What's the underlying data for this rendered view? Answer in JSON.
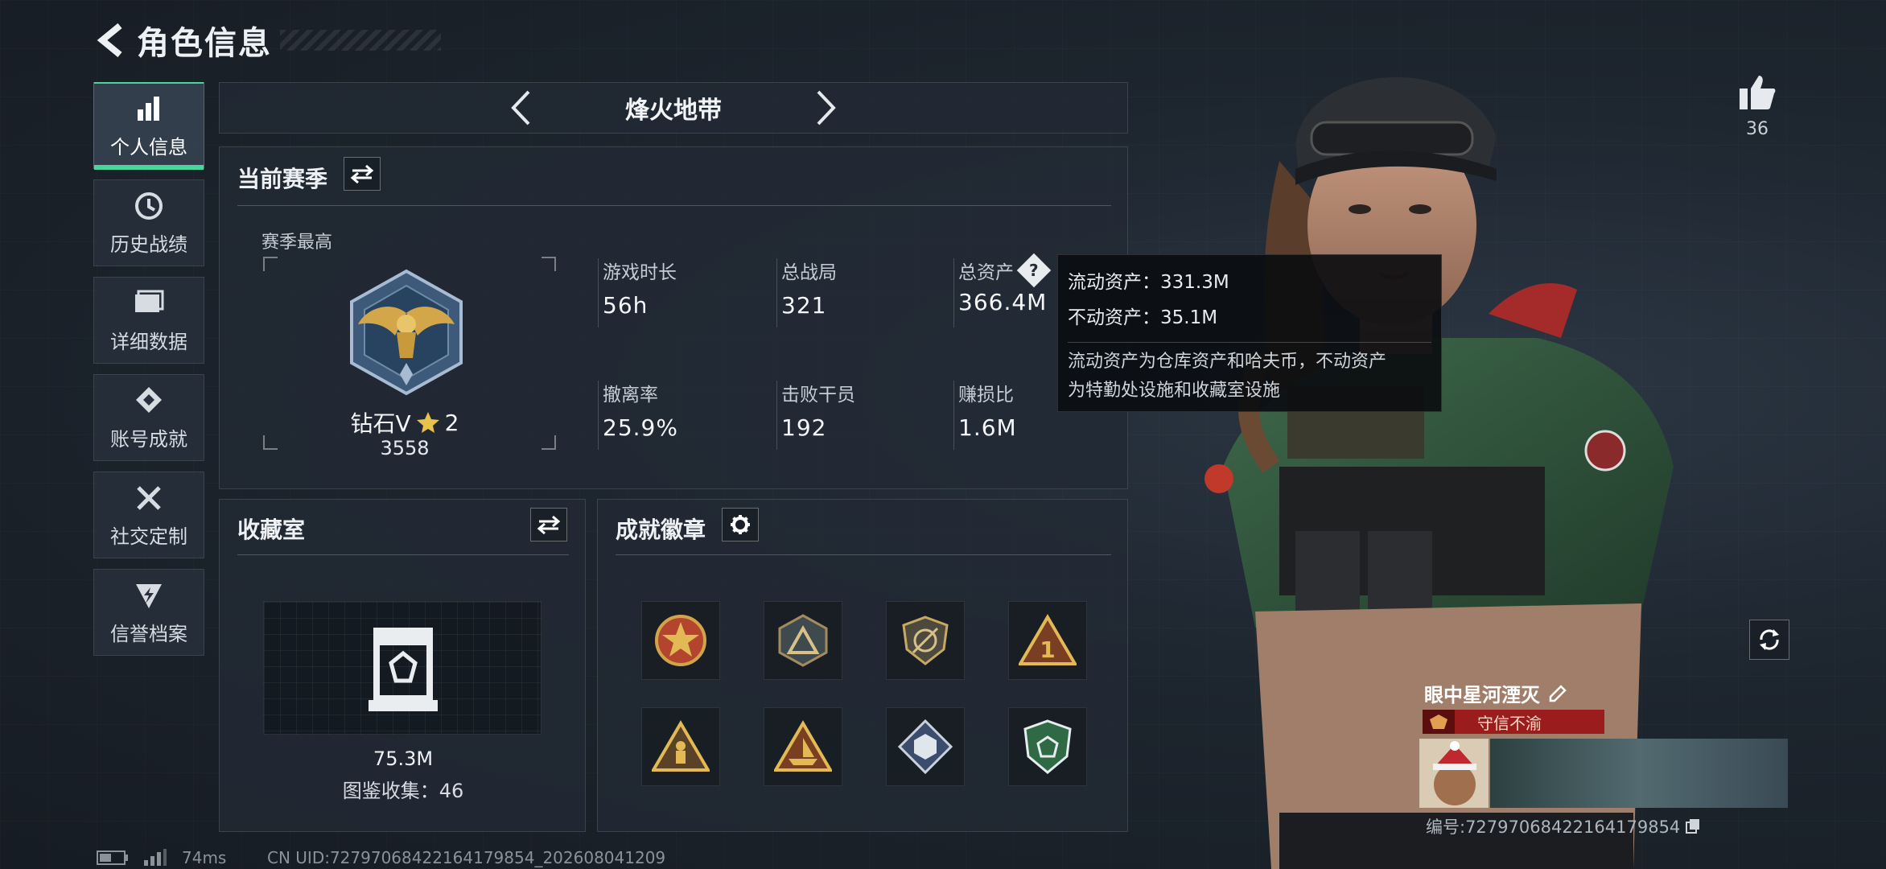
{
  "header": {
    "title": "角色信息"
  },
  "sidebar": {
    "items": [
      {
        "label": "个人信息",
        "icon": "bar-chart-icon",
        "active": true
      },
      {
        "label": "历史战绩",
        "icon": "history-icon",
        "active": false
      },
      {
        "label": "详细数据",
        "icon": "folder-icon",
        "active": false
      },
      {
        "label": "账号成就",
        "icon": "achievement-icon",
        "active": false
      },
      {
        "label": "社交定制",
        "icon": "tools-icon",
        "active": false
      },
      {
        "label": "信誉档案",
        "icon": "shield-bolt-icon",
        "active": false
      }
    ]
  },
  "mode": {
    "title": "烽火地带"
  },
  "season": {
    "title": "当前赛季",
    "best_label": "赛季最高",
    "rank_name": "钻石V",
    "rank_stars": "2",
    "rank_score": "3558",
    "stats": [
      {
        "label": "游戏时长",
        "value": "56h"
      },
      {
        "label": "总战局",
        "value": "321"
      },
      {
        "label": "总资产",
        "value": "366.4M"
      },
      {
        "label": "撤离率",
        "value": "25.9%"
      },
      {
        "label": "击败干员",
        "value": "192"
      },
      {
        "label": "赚损比",
        "value": "1.6M"
      }
    ]
  },
  "tooltip": {
    "line1": "流动资产：331.3M",
    "line2": "不动资产：35.1M",
    "desc1": "流动资产为仓库资产和哈夫币，不动资产",
    "desc2": "为特勤处设施和收藏室设施"
  },
  "collection": {
    "title": "收藏室",
    "value": "75.3M",
    "catalog": "图鉴收集：46"
  },
  "badges": {
    "title": "成就徽章",
    "items": [
      "star-medal-badge",
      "triangle-badge",
      "slash-shield-badge",
      "number-one-badge",
      "soldier-triangle-badge",
      "boat-triangle-badge",
      "cube-diamond-badge",
      "green-shield-badge"
    ]
  },
  "profile": {
    "likes": "36",
    "name": "眼中星河湮灭",
    "title_badge": "守信不渝",
    "id_text": "编号:727970684221641798​54"
  },
  "footer": {
    "ping": "74ms",
    "uid": "CN UID:727970684221641798​54_202608041209"
  },
  "colors": {
    "accent": "#49d69a",
    "badge_red": "#9a1c1c"
  }
}
